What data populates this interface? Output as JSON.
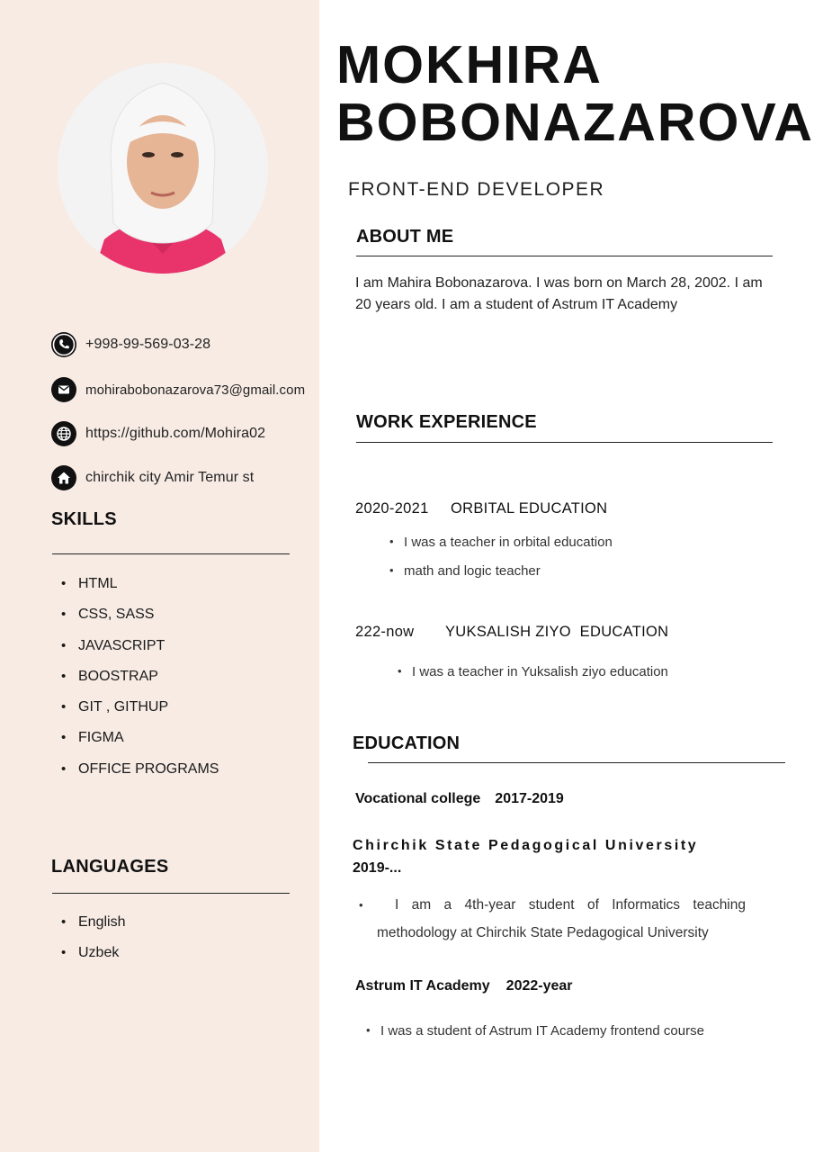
{
  "name": {
    "line1": "MOKHIRA",
    "line2": "BOBONAZAROVA"
  },
  "role": "FRONT-END DEVELOPER",
  "contacts": [
    {
      "icon": "phone-icon",
      "text": "+998-99-569-03-28"
    },
    {
      "icon": "email-icon",
      "text": "mohirabobonazarova73@gmail.com"
    },
    {
      "icon": "globe-icon",
      "text": "https://github.com/Mohira02"
    },
    {
      "icon": "home-icon",
      "text": "chirchik city Amir Temur st"
    }
  ],
  "skills": {
    "heading": "SKILLS",
    "items": [
      "HTML",
      "CSS, SASS",
      "JAVASCRIPT",
      "BOOSTRAP",
      "GIT , GITHUP",
      "FIGMA",
      "OFFICE PROGRAMS"
    ]
  },
  "languages": {
    "heading": "LANGUAGES",
    "items": [
      "English",
      "Uzbek"
    ]
  },
  "about": {
    "heading": "ABOUT ME",
    "text": "I am Mahira Bobonazarova. I was born on March 28, 2002. I am 20 years old. I am a student of Astrum IT Academy"
  },
  "work": {
    "heading": "WORK EXPERIENCE",
    "jobs": [
      {
        "years": "2020-2021",
        "org": "ORBITAL EDUCATION",
        "bullets": [
          "I was a teacher in orbital education",
          "math and logic teacher"
        ]
      },
      {
        "years": "222-now",
        "org": "YUKSALISH ZIYO  EDUCATION",
        "bullets": [
          "I was a teacher in Yuksalish ziyo education"
        ]
      }
    ]
  },
  "education": {
    "heading": "EDUCATION",
    "entries": [
      {
        "title": "Vocational college",
        "years": "2017-2019"
      },
      {
        "title": "Chirchik State Pedagogical University",
        "years": "2019-...",
        "text": "I am a 4th-year student of Informatics teaching methodology at Chirchik State Pedagogical University"
      },
      {
        "title": "Astrum IT Academy",
        "years": "2022-year",
        "text": "I was a student of Astrum IT Academy frontend course"
      }
    ]
  },
  "colors": {
    "sidebar": "#f7ebe4",
    "text": "#111111",
    "accent_shirt": "#e8336b"
  }
}
